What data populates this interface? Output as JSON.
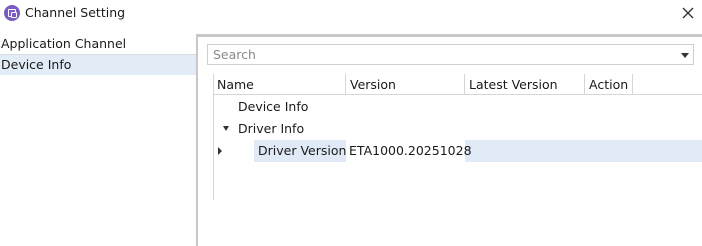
{
  "window": {
    "title": "Channel Setting",
    "app_icon": "app-icon",
    "close_icon": "close-icon"
  },
  "sidebar": {
    "items": [
      {
        "label": "Application Channel",
        "selected": false
      },
      {
        "label": "Device Info",
        "selected": true
      }
    ]
  },
  "search": {
    "value": "",
    "placeholder": "Search"
  },
  "grid": {
    "columns": [
      "Name",
      "Version",
      "Latest Version",
      "Action"
    ],
    "rows": [
      {
        "name": "Device Info",
        "version": "",
        "latest_version": "",
        "action": ""
      },
      {
        "name": "Driver Info",
        "version": "",
        "latest_version": "",
        "action": "",
        "expanded": true
      },
      {
        "name": "Driver Version",
        "version": "ETA1000.20251028",
        "latest_version": "",
        "action": "",
        "selected": true
      }
    ]
  },
  "colors": {
    "accent": "#7b5cc4",
    "selection": "#dfeaf6"
  }
}
